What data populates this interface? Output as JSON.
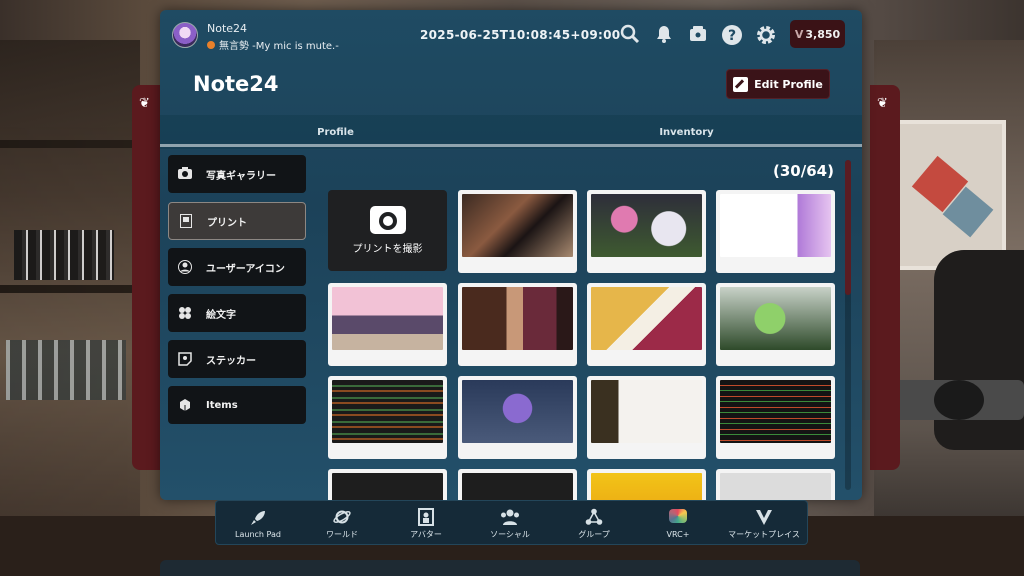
{
  "topbar": {
    "username": "Note24",
    "status_text": "無言勢 -My mic is mute.-",
    "status_color": "#e8802a",
    "timestamp": "2025-06-25T10:08:45+09:00",
    "icons": [
      "search-icon",
      "bell-icon",
      "mailbox-icon",
      "help-icon",
      "gear-icon"
    ],
    "currency_symbol": "V",
    "currency_amount": "3,850"
  },
  "profile": {
    "title": "Note24",
    "edit_label": "Edit Profile"
  },
  "tabs": [
    {
      "label": "Profile"
    },
    {
      "label": "Inventory"
    }
  ],
  "sidebar": {
    "items": [
      {
        "label": "写真ギャラリー",
        "icon": "camera-icon"
      },
      {
        "label": "プリント",
        "icon": "print-icon",
        "active": true
      },
      {
        "label": "ユーザーアイコン",
        "icon": "user-icon"
      },
      {
        "label": "絵文字",
        "icon": "emoji-icon"
      },
      {
        "label": "ステッカー",
        "icon": "sticker-icon"
      },
      {
        "label": "Items",
        "icon": "items-icon"
      }
    ]
  },
  "gallery": {
    "count": "(30/64)",
    "capture_label": "プリントを撮影"
  },
  "dock": {
    "items": [
      {
        "label": "Launch Pad",
        "icon": "rocket-icon"
      },
      {
        "label": "ワールド",
        "icon": "planet-icon"
      },
      {
        "label": "アバター",
        "icon": "avatar-icon"
      },
      {
        "label": "ソーシャル",
        "icon": "social-icon"
      },
      {
        "label": "グループ",
        "icon": "group-icon"
      },
      {
        "label": "VRC+",
        "icon": "vrcplus-icon"
      },
      {
        "label": "マーケットプレイス",
        "icon": "marketplace-icon"
      }
    ]
  },
  "colors": {
    "panel": "#1f4b63",
    "accent_dark_red": "#3a1318",
    "sidebar_item": "#111417"
  }
}
